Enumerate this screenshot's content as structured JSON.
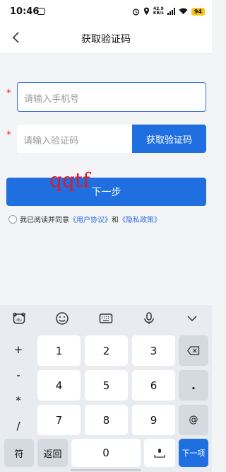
{
  "status_bar": {
    "time": "10:46",
    "speed_value": "42.9",
    "speed_unit": "KB/s",
    "network": "5G",
    "battery": "94"
  },
  "header": {
    "title": "获取验证码"
  },
  "form": {
    "phone_placeholder": "请输入手机号",
    "code_placeholder": "请输入验证码",
    "get_code_label": "获取验证码",
    "next_label": "下一步",
    "required_mark": "*"
  },
  "watermark": "qqtf",
  "agreement": {
    "prefix": "我已阅读并同意",
    "user_agreement": "《用户协议》",
    "conjunction": "和",
    "privacy_policy": "《隐私政策》"
  },
  "keyboard": {
    "toolbar_icons": [
      "emoticon-bear-icon",
      "smiley-icon",
      "keyboard-icon",
      "microphone-icon",
      "chevron-down-icon"
    ],
    "side_keys": [
      "+",
      "-",
      "*",
      "/"
    ],
    "digits": [
      "1",
      "2",
      "3",
      "4",
      "5",
      "6",
      "7",
      "8",
      "9"
    ],
    "dot": ".",
    "at": "@",
    "symbol_key": "符",
    "back_key": "返回",
    "zero": "0",
    "next_key": "下一项",
    "backspace_icon": "backspace-icon",
    "space_icon": "space-icon"
  }
}
